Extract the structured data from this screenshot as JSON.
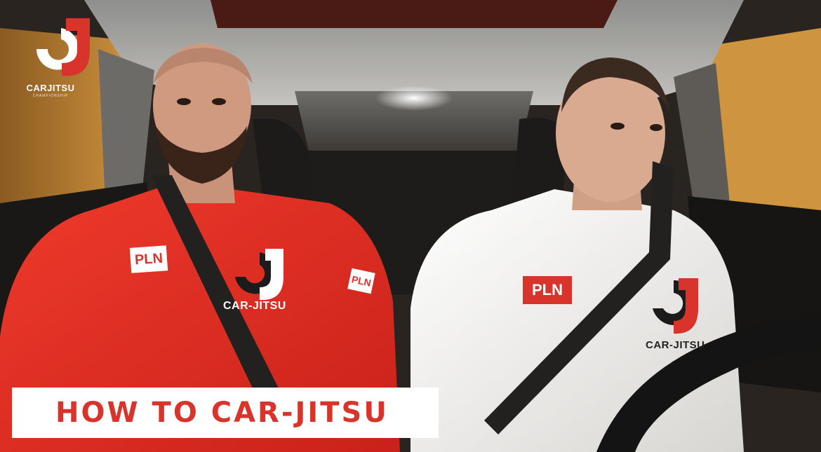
{
  "scene": {
    "description_colors": {
      "left_shirt": "#e02a1f",
      "right_shirt": "#f2f1ee",
      "brand_red": "#d9342b",
      "cabin_orange": "#c98a3a"
    }
  },
  "logo": {
    "wordmark": "CARJITSU",
    "subtitle": "CHAMPIONSHIP"
  },
  "caption": {
    "text": "HOW TO CAR-JITSU"
  },
  "left_person": {
    "patch_text": "PLN",
    "sleeve_patch_text": "PLN",
    "chest_text": "CAR-JITSU"
  },
  "right_person": {
    "patch_text": "PLN",
    "chest_text": "CAR-JITSU"
  }
}
